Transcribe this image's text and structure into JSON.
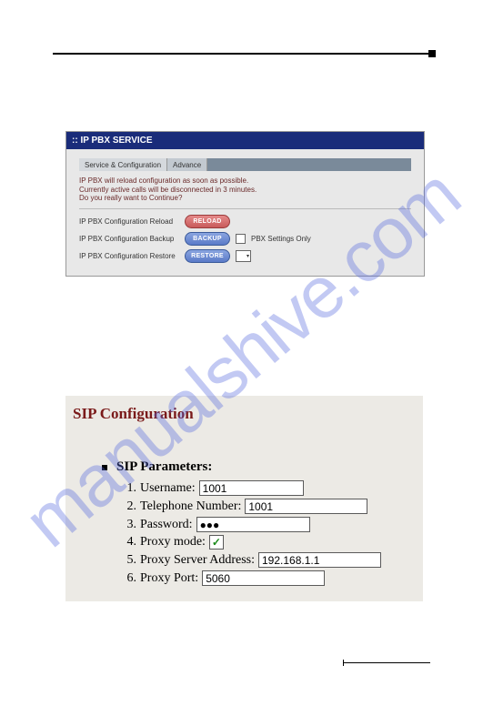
{
  "watermark": "manualshive.com",
  "panel1": {
    "title": ":: IP PBX SERVICE",
    "tabs": {
      "service": "Service & Configuration",
      "advance": "Advance"
    },
    "message_line1": "IP PBX will reload configuration as soon as possible.",
    "message_line2": "Currently active calls will be disconnected in 3 minutes.",
    "message_line3": "Do you really want to Continue?",
    "rows": {
      "reload": {
        "label": "IP PBX Configuration Reload",
        "button": "RELOAD"
      },
      "backup": {
        "label": "IP PBX Configuration Backup",
        "button": "BACKUP",
        "checkbox_label": "PBX Settings Only"
      },
      "restore": {
        "label": "IP PBX Configuration Restore",
        "button": "RESTORE"
      }
    }
  },
  "panel2": {
    "title": "SIP Configuration",
    "section_title": "SIP Parameters:",
    "params": {
      "username": {
        "num": "1.",
        "label": "Username:",
        "value": "1001"
      },
      "telephone": {
        "num": "2.",
        "label": "Telephone Number:",
        "value": "1001"
      },
      "password": {
        "num": "3.",
        "label": "Password:",
        "value": "●●●"
      },
      "proxymode": {
        "num": "4.",
        "label": "Proxy mode:",
        "checked": "✓"
      },
      "proxyaddr": {
        "num": "5.",
        "label": "Proxy Server Address:",
        "value": "192.168.1.1"
      },
      "proxyport": {
        "num": "6.",
        "label": "Proxy Port:",
        "value": "5060"
      }
    }
  }
}
